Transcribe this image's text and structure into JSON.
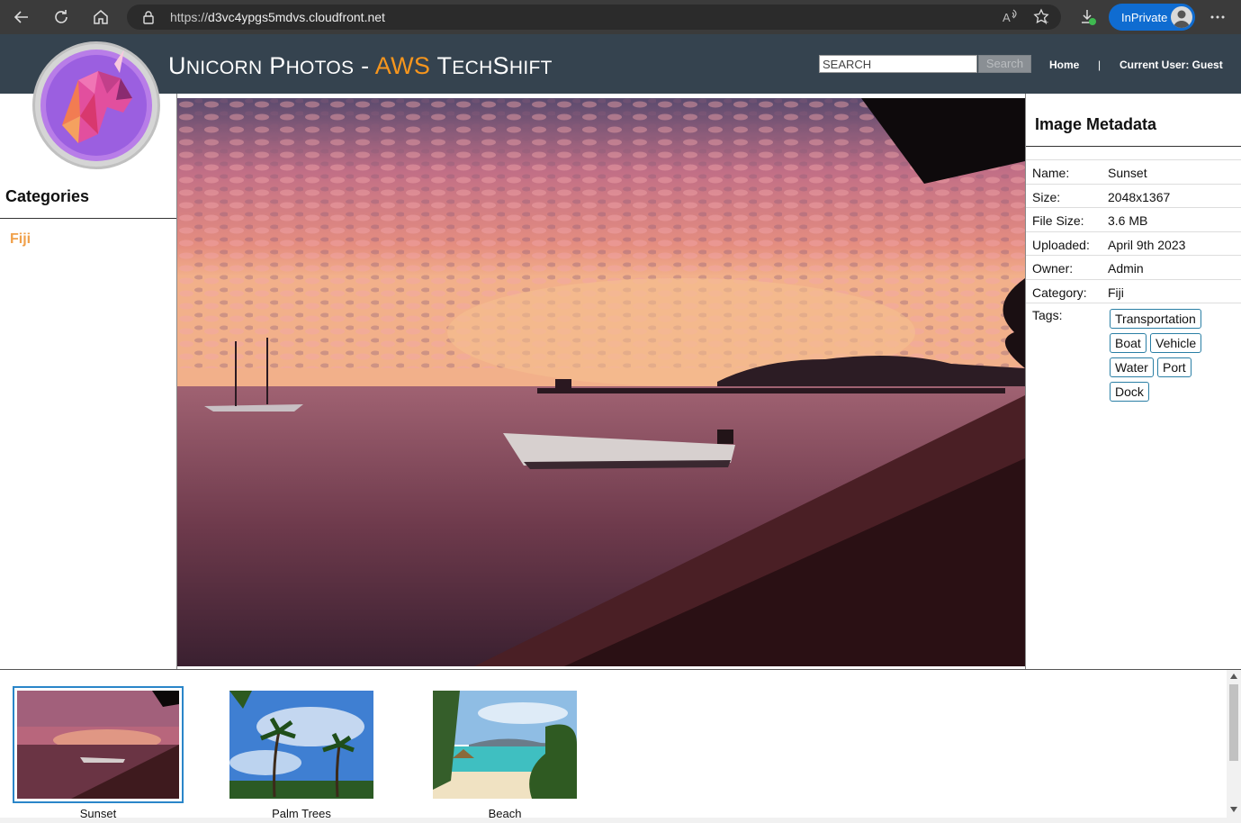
{
  "browser": {
    "url_scheme": "https://",
    "url_host": "d3vc4ypgs5mdvs.cloudfront.net",
    "inprivate_label": "InPrivate"
  },
  "header": {
    "title_u": "U",
    "title_nicorn": "NICORN",
    "title_p": " P",
    "title_hotos": "HOTOS",
    "title_dash": " - ",
    "title_aws": "AWS",
    "title_t": " T",
    "title_ech": "ECH",
    "title_s": "S",
    "title_hift": "HIFT",
    "search_placeholder": "SEARCH",
    "search_button": "Search",
    "home_link": "Home",
    "separator": "|",
    "current_user": "Current User: Guest"
  },
  "sidebar": {
    "title": "Categories",
    "items": [
      {
        "label": "Fiji"
      }
    ]
  },
  "metadata": {
    "title": "Image Metadata",
    "rows": [
      {
        "key": "Name:",
        "value": "Sunset"
      },
      {
        "key": "Size:",
        "value": "2048x1367"
      },
      {
        "key": "File Size:",
        "value": "3.6 MB"
      },
      {
        "key": "Uploaded:",
        "value": "April 9th 2023"
      },
      {
        "key": "Owner:",
        "value": "Admin"
      },
      {
        "key": "Category:",
        "value": "Fiji"
      }
    ],
    "tags_label": "Tags:",
    "tags": [
      "Transportation",
      "Boat",
      "Vehicle",
      "Water",
      "Port",
      "Dock"
    ]
  },
  "thumbnails": [
    {
      "label": "Sunset",
      "selected": true
    },
    {
      "label": "Palm Trees",
      "selected": false
    },
    {
      "label": "Beach",
      "selected": false
    }
  ],
  "colors": {
    "header_bg": "#35434f",
    "accent_orange": "#f7961d",
    "selected_border": "#2a86c9",
    "tag_border": "#2a7fa5"
  }
}
